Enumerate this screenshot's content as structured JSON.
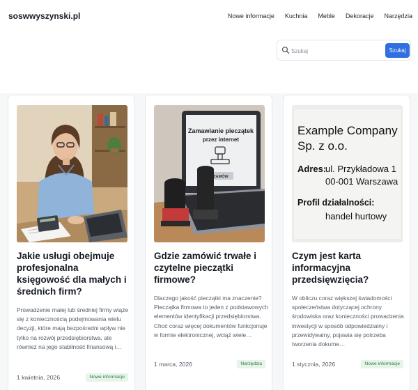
{
  "site": {
    "logo": "soswwyszynski.pl"
  },
  "nav": {
    "items": [
      "Nowe informacje",
      "Kuchnia",
      "Meble",
      "Dekoracje",
      "Narzędzia"
    ]
  },
  "search": {
    "placeholder": "Szukaj",
    "button": "Szukaj"
  },
  "articles": [
    {
      "title": "Jakie usługi obejmuje profesjonalna księgowość dla małych i średnich firm?",
      "excerpt": "Prowadzenie małej lub średniej firmy wiąże się z koniecznością podejmowania wielu decyzji, które mają bezpośredni wpływ nie tylko na rozwój przedsiębiorstwa, ale również na jego stabilność finansową i…",
      "date": "1 kwietnia, 2026",
      "category": "Nowe informacje"
    },
    {
      "title": "Gdzie zamówić trwałe i czytelne pieczątki firmowe?",
      "excerpt": "Dlaczego jakość pieczątki ma znaczenie? Pieczątka firmowa to jeden z podstawowych elementów identyfikacji przedsiębiorstwa. Choć coraz więcej dokumentów funkcjonuje w formie elektronicznej, wciąż wiele…",
      "date": "1 marca, 2026",
      "category": "Narzędzia",
      "image_text": {
        "screen_line1": "Zamawianie pieczątek",
        "screen_line2": "przez internet",
        "screen_button": "ZAMÓW"
      }
    },
    {
      "title": "Czym jest karta informacyjna przedsięwzięcia?",
      "excerpt": "W obliczu coraz większej świadomości społeczeństwa dotyczącej ochrony środowiska oraz konieczności prowadzenia inwestycji w sposób odpowiedzialny i przewidywalny, pojawia się potrzeba tworzenia dokume…",
      "date": "1 stycznia, 2026",
      "category": "Nowe informacje",
      "image_text": {
        "company_line1": "Example Company",
        "company_line2": "Sp. z o.o.",
        "address_label": "Adres:",
        "address_line1": "ul. Przykładowa 1",
        "address_line2": "00-001 Warszawa",
        "profile_label": "Profil działalności:",
        "profile_value": "handel hurtowy"
      }
    }
  ],
  "colors": {
    "accent": "#2f6fe0",
    "badge_bg": "#e6f4ea",
    "badge_text": "#2f7a45"
  }
}
